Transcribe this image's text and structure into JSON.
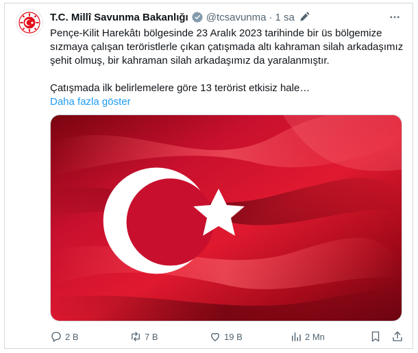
{
  "account": {
    "name": "T.C. Millî Savunma Bakanlığı",
    "handle": "@tcsavunma",
    "separator": "·",
    "time": "1 sa"
  },
  "tweet": {
    "paragraph1": "Pençe-Kilit Harekâtı bölgesinde 23 Aralık 2023 tarihinde bir üs bölgemize sızmaya çalışan teröristlerle çıkan çatışmada altı kahraman silah arkadaşımız şehit olmuş, bir kahraman silah arkadaşımız da yaralanmıştır.",
    "paragraph2": "Çatışmada ilk belirlemelere göre 13 terörist etkisiz hale…",
    "show_more": "Daha fazla göster"
  },
  "actions": {
    "replies": "2 B",
    "retweets": "7 B",
    "likes": "19 B",
    "views": "2 Mn"
  },
  "icons": {
    "verified": "verified-badge-icon",
    "edit": "edited-pencil-icon",
    "more": "more-options-icon",
    "reply": "reply-icon",
    "retweet": "retweet-icon",
    "like": "heart-icon",
    "views": "views-icon",
    "bookmark": "bookmark-icon",
    "share": "share-icon"
  },
  "colors": {
    "accent": "#1d9bf0",
    "text": "#0f1419",
    "muted": "#536471",
    "flag_red": "#c8102e",
    "logo_red": "#e30a17"
  }
}
